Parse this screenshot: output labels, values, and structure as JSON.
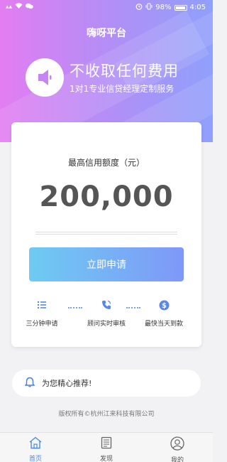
{
  "status_bar": {
    "signal": "ᴬᴸ",
    "battery": "98%",
    "time": "4:05"
  },
  "header": {
    "title": "嗨呀平台"
  },
  "promo": {
    "title": "不收取任何费用",
    "subtitle": "1对1专业信贷经理定制服务",
    "icon": "speaker-icon"
  },
  "card": {
    "limit_label": "最高信用额度（元）",
    "limit_amount": "200,000",
    "apply_button": "立即申请",
    "steps": [
      {
        "label": "三分钟申请",
        "icon": "list-icon"
      },
      {
        "label": "顾问实时审核",
        "icon": "phone-icon"
      },
      {
        "label": "最快当天到款",
        "icon": "dollar-icon"
      }
    ]
  },
  "recommend": {
    "text": "为您精心推荐!",
    "icon": "bell-icon"
  },
  "footer": {
    "copyright": "版权所有©杭州江来科技有限公司"
  },
  "tabbar": {
    "tabs": [
      {
        "label": "首页",
        "icon": "home-icon",
        "active": true
      },
      {
        "label": "发现",
        "icon": "document-icon",
        "active": false
      },
      {
        "label": "我的",
        "icon": "user-icon",
        "active": false
      }
    ]
  },
  "colors": {
    "gradient_start": "#e37df2",
    "gradient_end": "#8fa0fb",
    "button_start": "#6ecbf2",
    "button_end": "#7f98f8",
    "accent_blue": "#4a8be0"
  }
}
